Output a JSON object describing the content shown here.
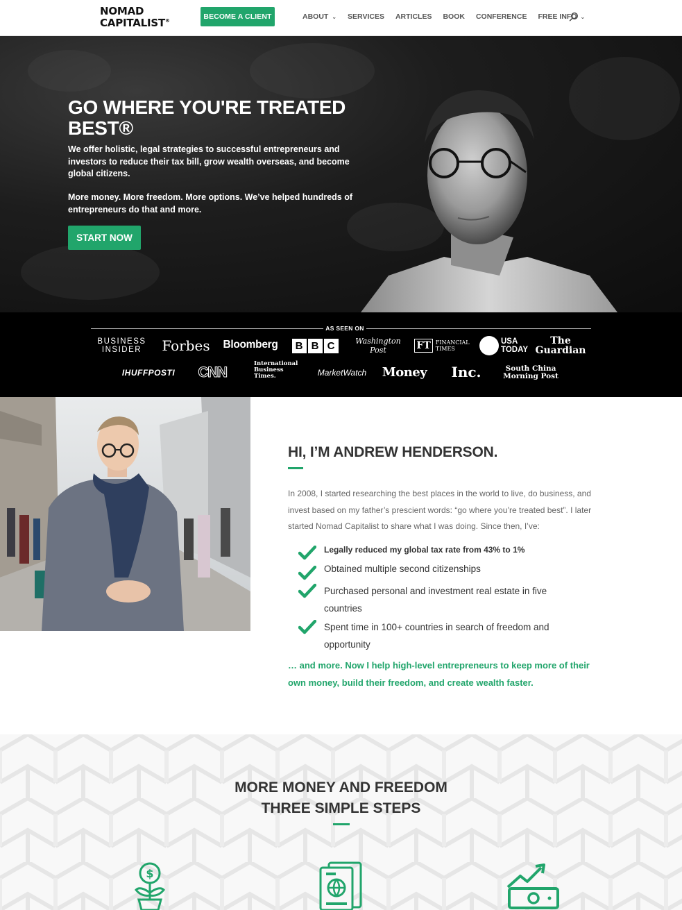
{
  "header": {
    "logo_line1": "NOMAD",
    "logo_line2": "CAPITALIST",
    "logo_reg": "®",
    "cta_label": "BECOME A CLIENT",
    "nav": [
      {
        "label": "ABOUT",
        "has_dropdown": true
      },
      {
        "label": "SERVICES",
        "has_dropdown": false
      },
      {
        "label": "ARTICLES",
        "has_dropdown": false
      },
      {
        "label": "BOOK",
        "has_dropdown": false
      },
      {
        "label": "CONFERENCE",
        "has_dropdown": false
      },
      {
        "label": "FREE INFO",
        "has_dropdown": true
      }
    ],
    "search_icon": "search-icon"
  },
  "hero": {
    "title": "GO WHERE YOU'RE TREATED BEST®",
    "paragraph1": "We offer holistic, legal strategies to successful entrepreneurs and investors to reduce their tax bill, grow wealth overseas, and become global citizens.",
    "paragraph2": "More money. More freedom. More options. We’ve helped hundreds of entrepreneurs do that and more.",
    "button_label": "START NOW"
  },
  "press": {
    "label": "AS SEEN ON",
    "row1": {
      "business_insider_1": "BUSINESS",
      "business_insider_2": "INSIDER",
      "forbes": "Forbes",
      "bloomberg": "Bloomberg",
      "bbc": [
        "B",
        "B",
        "C"
      ],
      "washington_post_1": "Washington",
      "washington_post_2": "Post",
      "ft_mark": "FT",
      "ft_1": "FINANCIAL",
      "ft_2": "TIMES",
      "usa_today_1": "USA",
      "usa_today_2": "TODAY",
      "guardian_1": "The",
      "guardian_2": "Guardian"
    },
    "row2": {
      "huffpost": "IHUFFPOSTI",
      "cnn": "CNN",
      "ibt_1": "International",
      "ibt_2": "Business",
      "ibt_3": "Times.",
      "marketwatch": "MarketWatch",
      "money": "Money",
      "inc": "Inc.",
      "scmp_1": "South China",
      "scmp_2": "Morning Post"
    }
  },
  "about": {
    "title": "HI, I’M ANDREW HENDERSON.",
    "intro": "In 2008, I started researching the best places in the world to live, do business, and invest based on my father’s prescient words: “go where you’re treated best”. I later started Nomad Capitalist to share what I was doing. Since then, I’ve:",
    "checks": [
      "Legally reduced my global tax rate from 43% to 1%",
      "Obtained multiple second citizenships",
      "Purchased personal and investment real estate in five countries",
      "Spent time in 100+ countries in search of freedom and opportunity"
    ],
    "closing": "… and more. Now I help high-level entrepreneurs to keep more of their own money, build their freedom, and create wealth faster."
  },
  "steps": {
    "title_line1": "MORE MONEY AND FREEDOM",
    "title_line2": "THREE SIMPLE STEPS",
    "icons": [
      "money-plant-icon",
      "passport-icon",
      "cash-growth-icon"
    ]
  },
  "colors": {
    "brand_green": "#21a56b",
    "text_dark": "#333333",
    "text_muted": "#666666"
  }
}
